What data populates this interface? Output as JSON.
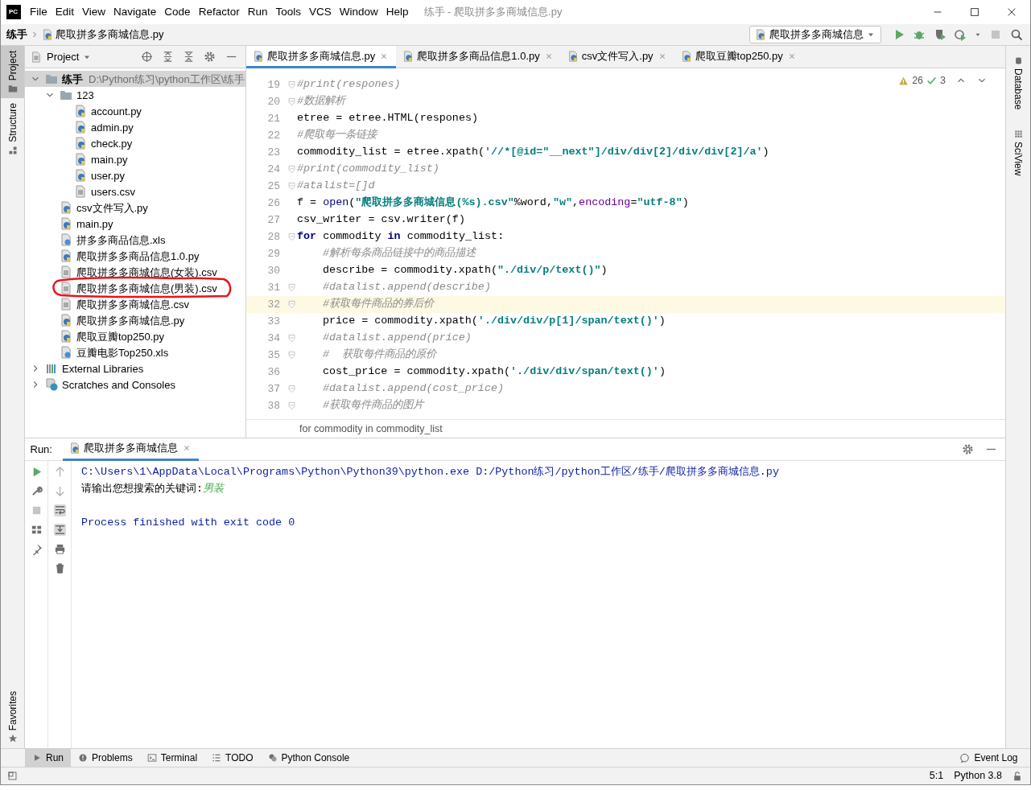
{
  "window": {
    "logo": "PC",
    "title": "练手 - 爬取拼多多商城信息.py"
  },
  "menu": [
    "File",
    "Edit",
    "View",
    "Navigate",
    "Code",
    "Refactor",
    "Run",
    "Tools",
    "VCS",
    "Window",
    "Help"
  ],
  "breadcrumb": [
    "练手",
    "爬取拼多多商城信息.py"
  ],
  "run_config": "爬取拼多多商城信息",
  "left_stripe": {
    "top": [
      {
        "label": "Project",
        "selected": true
      },
      {
        "label": "Structure",
        "selected": false
      }
    ],
    "bottom": [
      {
        "label": "Favorites",
        "selected": false
      }
    ]
  },
  "project": {
    "title": "Project",
    "tree": [
      {
        "kind": "folder",
        "name": "练手",
        "path": "D:\\Python练习\\python工作区\\练手",
        "expanded": true,
        "children": [
          {
            "kind": "folder",
            "name": "123",
            "expanded": true,
            "children": [
              {
                "kind": "python",
                "name": "account.py"
              },
              {
                "kind": "python",
                "name": "admin.py"
              },
              {
                "kind": "python",
                "name": "check.py"
              },
              {
                "kind": "python",
                "name": "main.py"
              },
              {
                "kind": "python",
                "name": "user.py"
              },
              {
                "kind": "text",
                "name": "users.csv"
              }
            ]
          },
          {
            "kind": "python",
            "name": "csv文件写入.py"
          },
          {
            "kind": "python",
            "name": "main.py"
          },
          {
            "kind": "unknown",
            "name": "拼多多商品信息.xls"
          },
          {
            "kind": "python",
            "name": "爬取拼多多商品信息1.0.py"
          },
          {
            "kind": "text",
            "name": "爬取拼多多商城信息(女装).csv"
          },
          {
            "kind": "text",
            "name": "爬取拼多多商城信息(男装).csv"
          },
          {
            "kind": "text",
            "name": "爬取拼多多商城信息.csv"
          },
          {
            "kind": "python",
            "name": "爬取拼多多商城信息.py"
          },
          {
            "kind": "python",
            "name": "爬取豆瓣top250.py"
          },
          {
            "kind": "unknown",
            "name": "豆瓣电影Top250.xls"
          }
        ]
      },
      {
        "kind": "libraries",
        "name": "External Libraries",
        "expanded": false
      },
      {
        "kind": "scratches",
        "name": "Scratches and Consoles",
        "expanded": false
      }
    ]
  },
  "tabs": [
    {
      "label": "爬取拼多多商城信息.py",
      "selected": true
    },
    {
      "label": "爬取拼多多商品信息1.0.py",
      "selected": false
    },
    {
      "label": "csv文件写入.py",
      "selected": false
    },
    {
      "label": "爬取豆瓣top250.py",
      "selected": false
    }
  ],
  "editor": {
    "inspections": {
      "warnings": "26",
      "weak_warnings": "3"
    },
    "lines": [
      {
        "number": "19",
        "fold": true,
        "current": false,
        "tokens": [
          {
            "kind": "cmt",
            "t": "#print(respones)"
          }
        ]
      },
      {
        "number": "20",
        "fold": true,
        "current": false,
        "tokens": [
          {
            "kind": "cmt",
            "t": "#数据解析"
          }
        ]
      },
      {
        "number": "21",
        "fold": false,
        "current": false,
        "tokens": [
          {
            "kind": "plain",
            "t": "etree = etree.HTML(respones)"
          }
        ]
      },
      {
        "number": "22",
        "fold": false,
        "current": false,
        "tokens": [
          {
            "kind": "cmt",
            "t": "#爬取每一条链接"
          }
        ]
      },
      {
        "number": "23",
        "fold": false,
        "current": false,
        "tokens": [
          {
            "kind": "plain",
            "t": "commodity_list = etree.xpath("
          },
          {
            "kind": "str",
            "t": "'//*[@id=\"__next\"]/div/div[2]/div/div[2]/a'"
          },
          {
            "kind": "plain",
            "t": ")"
          }
        ]
      },
      {
        "number": "24",
        "fold": true,
        "current": false,
        "tokens": [
          {
            "kind": "cmt",
            "t": "#print(commodity_list)"
          }
        ]
      },
      {
        "number": "25",
        "fold": true,
        "current": false,
        "tokens": [
          {
            "kind": "cmt",
            "t": "#atalist=[]d"
          }
        ]
      },
      {
        "number": "26",
        "fold": false,
        "current": false,
        "tokens": [
          {
            "kind": "plain",
            "t": "f = "
          },
          {
            "kind": "fn",
            "t": "open"
          },
          {
            "kind": "plain",
            "t": "("
          },
          {
            "kind": "str",
            "t": "\"爬取拼多多商城信息(%s).csv\""
          },
          {
            "kind": "plain",
            "t": "%word,"
          },
          {
            "kind": "str",
            "t": "\"w\""
          },
          {
            "kind": "plain",
            "t": ","
          },
          {
            "kind": "kwarg",
            "t": "encoding"
          },
          {
            "kind": "plain",
            "t": "="
          },
          {
            "kind": "str",
            "t": "\"utf-8\""
          },
          {
            "kind": "plain",
            "t": ")"
          }
        ]
      },
      {
        "number": "27",
        "fold": false,
        "current": false,
        "tokens": [
          {
            "kind": "plain",
            "t": "csv_writer = csv.writer(f)"
          }
        ]
      },
      {
        "number": "28",
        "fold": true,
        "current": false,
        "tokens": [
          {
            "kind": "kw",
            "t": "for"
          },
          {
            "kind": "plain",
            "t": " commodity "
          },
          {
            "kind": "kw",
            "t": "in"
          },
          {
            "kind": "plain",
            "t": " commodity_list:"
          }
        ],
        "children": [
          {
            "number": "29",
            "fold": false,
            "current": false,
            "tokens": [
              {
                "kind": "cmt",
                "t": "#解析每条商品链接中的商品描述"
              }
            ]
          },
          {
            "number": "30",
            "fold": false,
            "current": false,
            "tokens": [
              {
                "kind": "plain",
                "t": "describe = commodity.xpath("
              },
              {
                "kind": "str",
                "t": "\"./div/p/text()\""
              },
              {
                "kind": "plain",
                "t": ")"
              }
            ]
          },
          {
            "number": "31",
            "fold": true,
            "current": false,
            "tokens": [
              {
                "kind": "cmt",
                "t": "#datalist.append(describe)"
              }
            ]
          },
          {
            "number": "32",
            "fold": true,
            "current": true,
            "tokens": [
              {
                "kind": "cmt",
                "t": "#获取每件商品的券后价"
              }
            ]
          },
          {
            "number": "33",
            "fold": false,
            "current": false,
            "tokens": [
              {
                "kind": "plain",
                "t": "price = commodity.xpath("
              },
              {
                "kind": "str",
                "t": "'./div/div/p[1]/span/text()'"
              },
              {
                "kind": "plain",
                "t": ")"
              }
            ]
          },
          {
            "number": "34",
            "fold": true,
            "current": false,
            "tokens": [
              {
                "kind": "cmt",
                "t": "#datalist.append(price)"
              }
            ]
          },
          {
            "number": "35",
            "fold": true,
            "current": false,
            "tokens": [
              {
                "kind": "cmt",
                "t": "#  获取每件商品的原价"
              }
            ]
          },
          {
            "number": "36",
            "fold": false,
            "current": false,
            "tokens": [
              {
                "kind": "plain",
                "t": "cost_price = commodity.xpath("
              },
              {
                "kind": "str",
                "t": "'./div/div/span/text()'"
              },
              {
                "kind": "plain",
                "t": ")"
              }
            ]
          },
          {
            "number": "37",
            "fold": true,
            "current": false,
            "tokens": [
              {
                "kind": "cmt",
                "t": "#datalist.append(cost_price)"
              }
            ]
          },
          {
            "number": "38",
            "fold": true,
            "current": false,
            "tokens": [
              {
                "kind": "cmt",
                "t": "#获取每件商品的图片"
              }
            ]
          }
        ]
      }
    ],
    "context": "for commodity in commodity_list"
  },
  "right_stripe": [
    "Database",
    "SciView"
  ],
  "run": {
    "label": "Run:",
    "tab": "爬取拼多多商城信息",
    "output": [
      {
        "kind": "command",
        "text": "C:\\Users\\1\\AppData\\Local\\Programs\\Python\\Python39\\python.exe D:/Python练习/python工作区/练手/爬取拼多多商城信息.py"
      },
      {
        "kind": "prompt",
        "text": "请输出您想搜索的关键词:",
        "input": "男装"
      },
      {
        "kind": "blank"
      },
      {
        "kind": "system",
        "text": "Process finished with exit code 0"
      }
    ]
  },
  "tool_windows": [
    {
      "label": "Run",
      "kind": "run",
      "selected": true
    },
    {
      "label": "Problems",
      "kind": "problems",
      "selected": false
    },
    {
      "label": "Terminal",
      "kind": "terminal",
      "selected": false
    },
    {
      "label": "TODO",
      "kind": "todo",
      "selected": false
    },
    {
      "label": "Python Console",
      "kind": "console",
      "selected": false
    }
  ],
  "event_log": "Event Log",
  "status": {
    "position": "5:1",
    "interpreter": "Python 3.8"
  }
}
